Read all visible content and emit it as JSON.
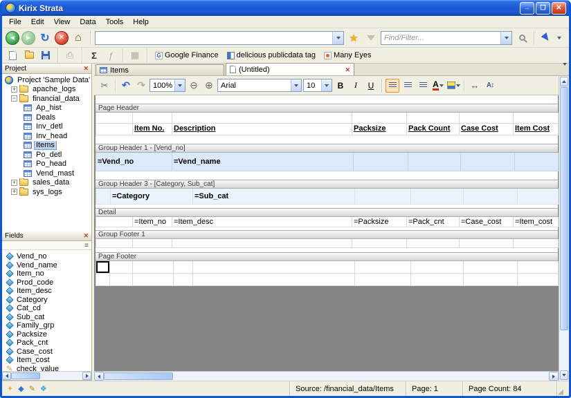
{
  "titlebar": {
    "title": "Kirix Strata"
  },
  "menubar": {
    "items": [
      "File",
      "Edit",
      "View",
      "Data",
      "Tools",
      "Help"
    ]
  },
  "nav_toolbar": {
    "address_value": "",
    "find_placeholder": "Find/Filter..."
  },
  "links_toolbar": {
    "links": [
      {
        "label": "Google Finance"
      },
      {
        "label": "delicious publicdata tag"
      },
      {
        "label": "Many Eyes"
      }
    ]
  },
  "project_panel": {
    "title": "Project",
    "items": [
      {
        "label": "Project 'Sample Data'"
      },
      {
        "label": "apache_logs"
      },
      {
        "label": "financial_data"
      },
      {
        "label": "Ap_hist"
      },
      {
        "label": "Deals"
      },
      {
        "label": "Inv_detl"
      },
      {
        "label": "Inv_head"
      },
      {
        "label": "Items"
      },
      {
        "label": "Po_detl"
      },
      {
        "label": "Po_head"
      },
      {
        "label": "Vend_mast"
      },
      {
        "label": "sales_data"
      },
      {
        "label": "sys_logs"
      }
    ]
  },
  "fields_panel": {
    "title": "Fields",
    "fields": [
      "Vend_no",
      "Vend_name",
      "Item_no",
      "Prod_code",
      "Item_desc",
      "Category",
      "Cat_cd",
      "Sub_cat",
      "Family_grp",
      "Packsize",
      "Pack_cnt",
      "Case_cost",
      "Item_cost",
      "check_value"
    ]
  },
  "tabbar": {
    "tabs": [
      {
        "label": "Items"
      },
      {
        "label": "(Untitled)"
      }
    ]
  },
  "designer_toolbar": {
    "zoom": "100%",
    "font": "Arial",
    "font_size": "10",
    "bold": "B",
    "italic": "I",
    "underline": "U",
    "color": "A"
  },
  "report": {
    "bands": {
      "page_header": {
        "label": "Page Header",
        "columns": [
          "Item No.",
          "Description",
          "Packsize",
          "Pack Count",
          "Case Cost",
          "Item Cost"
        ]
      },
      "group_header_1": {
        "label": "Group Header 1 - [Vend_no]",
        "fields": [
          "=Vend_no",
          "=Vend_name"
        ]
      },
      "group_header_3": {
        "label": "Group Header 3 - [Category, Sub_cat]",
        "fields": [
          "=Category",
          "=Sub_cat"
        ]
      },
      "detail": {
        "label": "Detail",
        "fields": [
          "=Item_no",
          "=Item_desc",
          "=Packsize",
          "=Pack_cnt",
          "=Case_cost",
          "=Item_cost"
        ]
      },
      "group_footer_1": {
        "label": "Group Footer 1"
      },
      "page_footer": {
        "label": "Page Footer"
      }
    }
  },
  "statusbar": {
    "source": "Source: /financial_data/Items",
    "page": "Page: 1",
    "page_count": "Page Count: 84"
  }
}
